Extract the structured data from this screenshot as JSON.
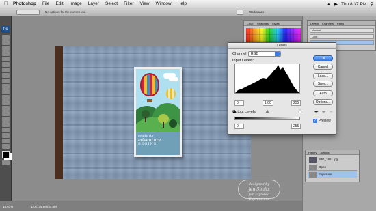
{
  "menubar": {
    "app": "Photoshop",
    "items": [
      "File",
      "Edit",
      "Image",
      "Layer",
      "Select",
      "Filter",
      "View",
      "Window",
      "Help"
    ],
    "clock": "Thu 8:37 PM"
  },
  "options_bar": {
    "note": "No options for the current tool.",
    "workspace": "Workspace"
  },
  "toolbox": {
    "logo": "Ps"
  },
  "status": {
    "zoom": "16.67%",
    "doc": "Doc: 34.8M/34.8M"
  },
  "card": {
    "text_top": "ready for",
    "text_main": "adventure",
    "text_sub": "BEGINS"
  },
  "watermark": {
    "line1": "designed by",
    "line2": "Jen Shults",
    "line3": "for Taylored Expressions"
  },
  "swatches_panel": {
    "tabs": [
      "Color",
      "Swatches",
      "Styles"
    ]
  },
  "layers_panel": {
    "tabs": [
      "Layers",
      "Channels",
      "Paths"
    ],
    "mode": "Normal",
    "lock": "Lock"
  },
  "history_panel": {
    "tabs": [
      "History",
      "Actions"
    ],
    "items": [
      "IMG_1851.jpg",
      "Open",
      "Exposure"
    ],
    "selected": "Exposure"
  },
  "levels_dialog": {
    "title": "Levels",
    "channel_label": "Channel:",
    "channel_value": "RGB",
    "input_label": "Input Levels:",
    "input_values": [
      "0",
      "1.00",
      "255"
    ],
    "output_label": "Output Levels:",
    "output_values": [
      "0",
      "255"
    ],
    "buttons": [
      "OK",
      "Cancel",
      "Load...",
      "Save...",
      "Auto",
      "Options..."
    ],
    "preview_label": "Preview",
    "preview_checked": true
  }
}
